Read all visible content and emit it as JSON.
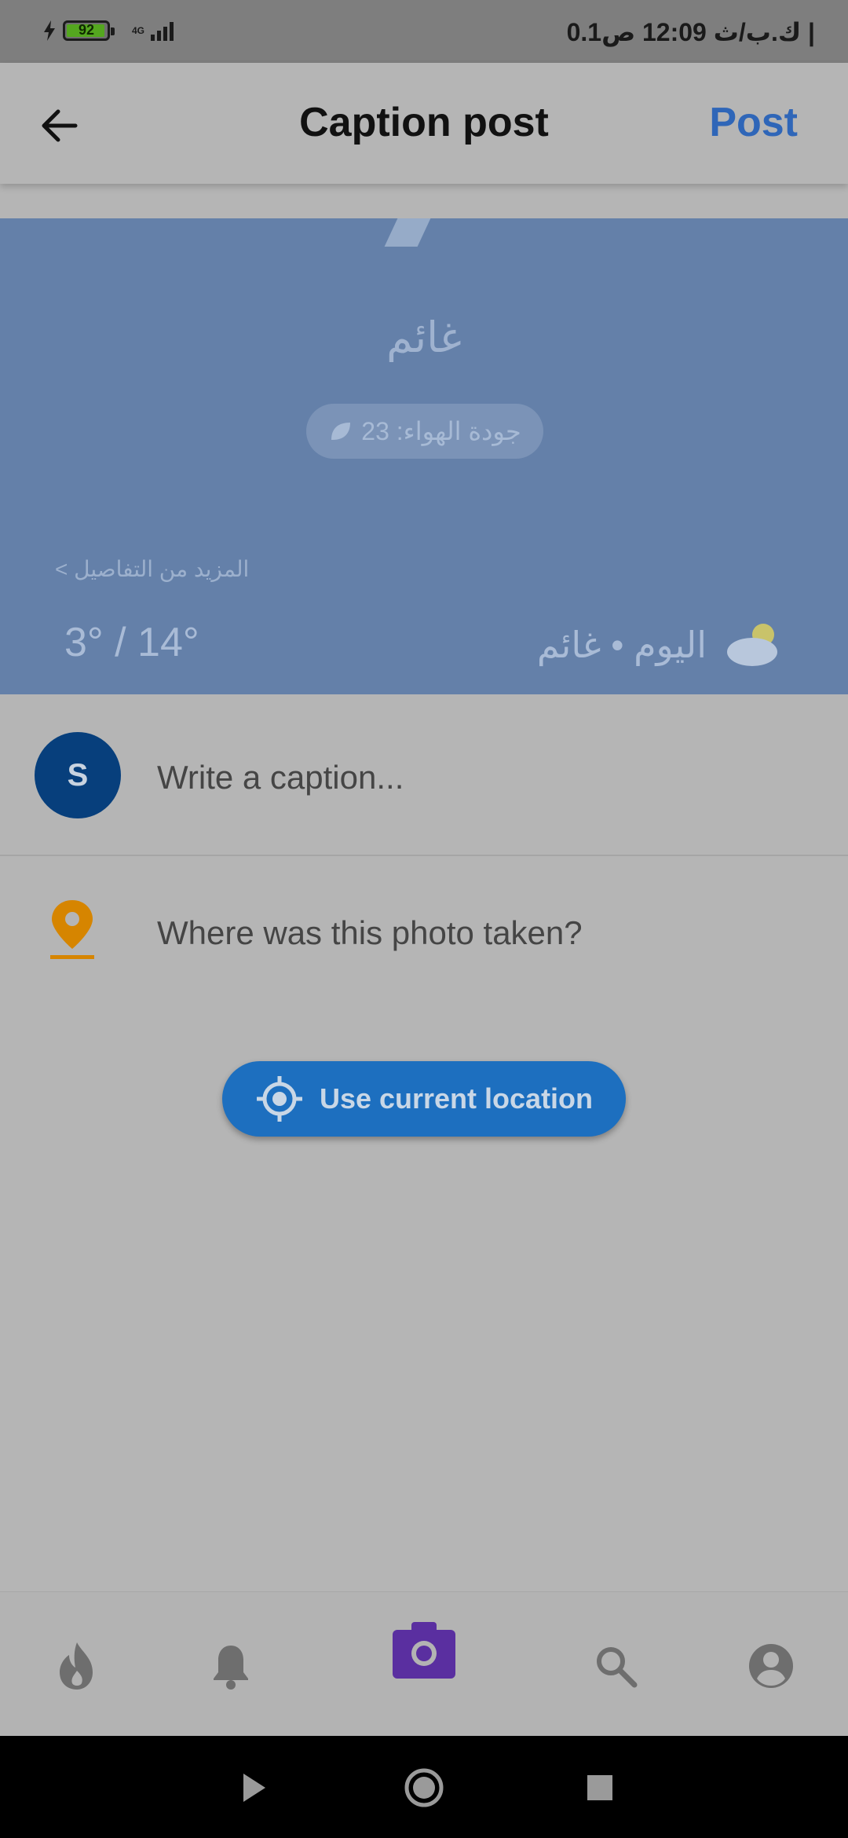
{
  "status_bar": {
    "battery_level": "92",
    "network_type": "4G",
    "speed": "0.1ك.ب/ث",
    "time_text": "12:09 ص | "
  },
  "app_bar": {
    "title": "Caption post",
    "post_label": "Post"
  },
  "photo": {
    "condition": "غائم",
    "air_quality": "جودة الهواء: 23",
    "more_details": "المزيد من التفاصيل",
    "temps": "3° / 14°",
    "today": "اليوم • غائم"
  },
  "caption": {
    "avatar_letter": "S",
    "placeholder": "Write a caption..."
  },
  "location": {
    "placeholder": "Where was this photo taken?",
    "use_current_label": "Use current location"
  },
  "bottom_nav": {
    "items": [
      "flame-icon",
      "bell-icon",
      "camera-icon",
      "search-icon",
      "account-icon"
    ]
  },
  "colors": {
    "accent": "#2f66b8",
    "button": "#1d6fbf",
    "pin": "#d68500",
    "camera_active": "#5a2fa0"
  }
}
